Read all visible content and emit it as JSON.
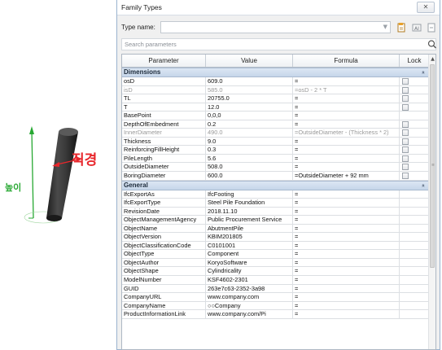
{
  "figure": {
    "diameter_label": "직경",
    "height_label": "높이",
    "colors": {
      "diameter": "#e8262b",
      "height": "#27a832",
      "pile": "#2f2f2f"
    }
  },
  "dialog": {
    "title": "Family Types",
    "close_icon": "close-icon",
    "type_name_label": "Type name:",
    "type_name_value": "",
    "search_placeholder": "Search parameters",
    "toolbar_icons": [
      "new-type-icon",
      "rename-type-icon",
      "delete-type-icon"
    ]
  },
  "grid": {
    "headers": {
      "parameter": "Parameter",
      "value": "Value",
      "formula": "Formula",
      "lock": "Lock"
    },
    "groups": [
      {
        "name": "Dimensions",
        "rows": [
          {
            "param": "osD",
            "value": "609.0",
            "formula": "=",
            "lock": true,
            "dim": false
          },
          {
            "param": "isD",
            "value": "585.0",
            "formula": "=osD - 2 * T",
            "lock": true,
            "dim": true
          },
          {
            "param": "TL",
            "value": "20755.0",
            "formula": "=",
            "lock": true,
            "dim": false
          },
          {
            "param": "T",
            "value": "12.0",
            "formula": "=",
            "lock": true,
            "dim": false
          },
          {
            "param": "BasePoint",
            "value": "0,0,0",
            "formula": "=",
            "lock": false,
            "dim": false
          },
          {
            "param": "DepthOfEmbedment",
            "value": "0.2",
            "formula": "=",
            "lock": true,
            "dim": false
          },
          {
            "param": "InnerDiameter",
            "value": "490.0",
            "formula": "=OutsideDiameter - (Thickness * 2)",
            "lock": true,
            "dim": true
          },
          {
            "param": "Thickness",
            "value": "9.0",
            "formula": "=",
            "lock": true,
            "dim": false
          },
          {
            "param": "ReinforcingFillHeight",
            "value": "0.3",
            "formula": "=",
            "lock": true,
            "dim": false
          },
          {
            "param": "PileLength",
            "value": "5.6",
            "formula": "=",
            "lock": true,
            "dim": false
          },
          {
            "param": "OutsideDiameter",
            "value": "508.0",
            "formula": "=",
            "lock": true,
            "dim": false
          },
          {
            "param": "BoringDiameter",
            "value": "600.0",
            "formula": "=OutsideDiameter + 92 mm",
            "lock": true,
            "dim": false
          }
        ]
      },
      {
        "name": "General",
        "rows": [
          {
            "param": "IfcExportAs",
            "value": "IfcFooting",
            "formula": "=",
            "lock": false,
            "dim": false
          },
          {
            "param": "IfcExportType",
            "value": "Steel Pile Foundation",
            "formula": "=",
            "lock": false,
            "dim": false
          },
          {
            "param": "RevisionDate",
            "value": "2018.11.10",
            "formula": "=",
            "lock": false,
            "dim": false
          },
          {
            "param": "ObjectManagementAgency",
            "value": "Public Procurement Service",
            "formula": "=",
            "lock": false,
            "dim": false
          },
          {
            "param": "ObjectName",
            "value": "AbutmentPile",
            "formula": "=",
            "lock": false,
            "dim": false
          },
          {
            "param": "ObjectVersion",
            "value": "KBIM201805",
            "formula": "=",
            "lock": false,
            "dim": false
          },
          {
            "param": "ObjectClassificationCode",
            "value": "C0101001",
            "formula": "=",
            "lock": false,
            "dim": false
          },
          {
            "param": "ObjectType",
            "value": "Component",
            "formula": "=",
            "lock": false,
            "dim": false
          },
          {
            "param": "ObjectAuthor",
            "value": "KoryoSoftware",
            "formula": "=",
            "lock": false,
            "dim": false
          },
          {
            "param": "ObjectShape",
            "value": "Cylindricality",
            "formula": "=",
            "lock": false,
            "dim": false
          },
          {
            "param": "ModelNumber",
            "value": "KSF4602-2301",
            "formula": "=",
            "lock": false,
            "dim": false
          },
          {
            "param": "GUID",
            "value": "263e7c63-2352-3a98",
            "formula": "=",
            "lock": false,
            "dim": false
          },
          {
            "param": "CompanyURL",
            "value": "www.company.com",
            "formula": "=",
            "lock": false,
            "dim": false
          },
          {
            "param": "CompanyName",
            "value": "○○Company",
            "formula": "=",
            "lock": false,
            "dim": false
          },
          {
            "param": "ProductInformationLink",
            "value": "www.company.com/Pi",
            "formula": "=",
            "lock": false,
            "dim": false
          }
        ]
      }
    ]
  }
}
